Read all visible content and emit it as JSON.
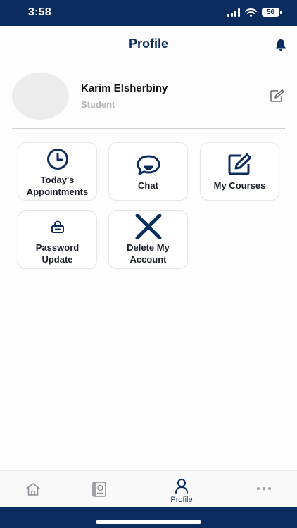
{
  "status_bar": {
    "time": "3:58",
    "battery": "56"
  },
  "header": {
    "title": "Profile"
  },
  "profile": {
    "name": "Karim Elsherbiny",
    "role": "Student"
  },
  "tiles": [
    {
      "label": "Today's\nAppointments",
      "icon": "clock-icon"
    },
    {
      "label": "Chat",
      "icon": "chat-bubble-icon"
    },
    {
      "label": "My Courses",
      "icon": "edit-note-icon"
    },
    {
      "label": "Password\nUpdate",
      "icon": "lock-icon"
    },
    {
      "label": "Delete My\nAccount",
      "icon": "close-x-icon"
    }
  ],
  "tabbar": {
    "active_label": "Profile"
  },
  "colors": {
    "primary": "#0b2c5e",
    "muted": "#b5b5b5",
    "background": "#fdfdfd"
  }
}
